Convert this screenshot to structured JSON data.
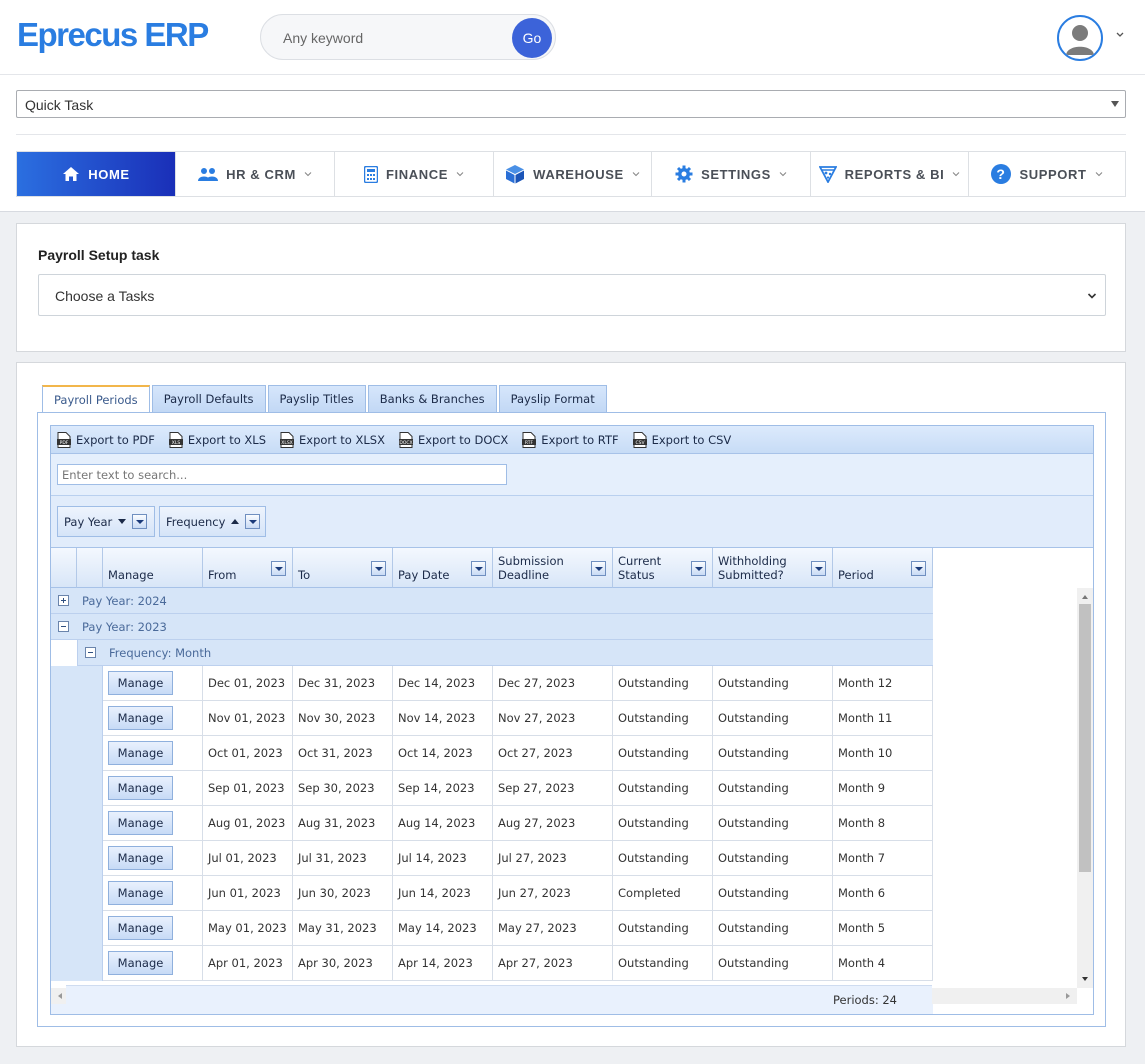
{
  "app": {
    "title": "Eprecus ERP"
  },
  "header": {
    "search_placeholder": "Any keyword",
    "go_label": "Go"
  },
  "quick_task": {
    "value": "Quick Task"
  },
  "nav": {
    "items": [
      {
        "label": "HOME",
        "icon": "home-icon",
        "active": true
      },
      {
        "label": "HR & CRM",
        "icon": "users-icon"
      },
      {
        "label": "FINANCE",
        "icon": "calculator-icon"
      },
      {
        "label": "WAREHOUSE",
        "icon": "box-icon"
      },
      {
        "label": "SETTINGS",
        "icon": "gear-icon"
      },
      {
        "label": "REPORTS & BI",
        "icon": "pizza-icon"
      },
      {
        "label": "SUPPORT",
        "icon": "question-icon"
      }
    ]
  },
  "setup": {
    "title": "Payroll Setup task",
    "select_value": "Choose a Tasks"
  },
  "tabs": [
    "Payroll Periods",
    "Payroll Defaults",
    "Payslip Titles",
    "Banks & Branches",
    "Payslip Format"
  ],
  "toolbar": [
    "Export to PDF",
    "Export to XLS",
    "Export to XLSX",
    "Export to DOCX",
    "Export to RTF",
    "Export to CSV"
  ],
  "toolbar_badges": [
    "PDF",
    "XLS",
    "XLSX",
    "DOCX",
    "RTF",
    "CSV"
  ],
  "grid": {
    "search_placeholder": "Enter text to search...",
    "group_by": [
      "Pay Year",
      "Frequency"
    ],
    "columns": [
      "Manage",
      "From",
      "To",
      "Pay Date",
      "Submission Deadline",
      "Current Status",
      "Withholding Submitted?",
      "Period"
    ],
    "groups": {
      "year_2024": "Pay Year: 2024",
      "year_2023": "Pay Year: 2023",
      "freq_month": "Frequency: Month"
    },
    "manage_label": "Manage",
    "rows": [
      [
        "Dec 01, 2023",
        "Dec 31, 2023",
        "Dec 14, 2023",
        "Dec 27, 2023",
        "Outstanding",
        "Outstanding",
        "Month 12"
      ],
      [
        "Nov 01, 2023",
        "Nov 30, 2023",
        "Nov 14, 2023",
        "Nov 27, 2023",
        "Outstanding",
        "Outstanding",
        "Month 11"
      ],
      [
        "Oct 01, 2023",
        "Oct 31, 2023",
        "Oct 14, 2023",
        "Oct 27, 2023",
        "Outstanding",
        "Outstanding",
        "Month 10"
      ],
      [
        "Sep 01, 2023",
        "Sep 30, 2023",
        "Sep 14, 2023",
        "Sep 27, 2023",
        "Outstanding",
        "Outstanding",
        "Month 9"
      ],
      [
        "Aug 01, 2023",
        "Aug 31, 2023",
        "Aug 14, 2023",
        "Aug 27, 2023",
        "Outstanding",
        "Outstanding",
        "Month 8"
      ],
      [
        "Jul 01, 2023",
        "Jul 31, 2023",
        "Jul 14, 2023",
        "Jul 27, 2023",
        "Outstanding",
        "Outstanding",
        "Month 7"
      ],
      [
        "Jun 01, 2023",
        "Jun 30, 2023",
        "Jun 14, 2023",
        "Jun 27, 2023",
        "Completed",
        "Outstanding",
        "Month 6"
      ],
      [
        "May 01, 2023",
        "May 31, 2023",
        "May 14, 2023",
        "May 27, 2023",
        "Outstanding",
        "Outstanding",
        "Month 5"
      ],
      [
        "Apr 01, 2023",
        "Apr 30, 2023",
        "Apr 14, 2023",
        "Apr 27, 2023",
        "Outstanding",
        "Outstanding",
        "Month 4"
      ]
    ],
    "footer": "Periods: 24"
  }
}
